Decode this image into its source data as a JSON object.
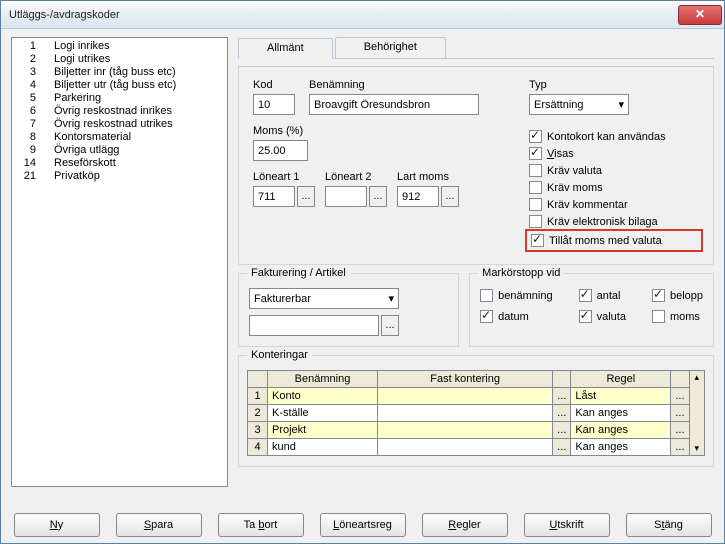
{
  "window": {
    "title": "Utläggs-/avdragskoder"
  },
  "list": [
    {
      "id": "1",
      "label": "Logi inrikes"
    },
    {
      "id": "2",
      "label": "Logi utrikes"
    },
    {
      "id": "3",
      "label": "Biljetter inr (tåg buss etc)"
    },
    {
      "id": "4",
      "label": "Biljetter utr (tåg buss etc)"
    },
    {
      "id": "5",
      "label": "Parkering"
    },
    {
      "id": "6",
      "label": "Övrig reskostnad inrikes"
    },
    {
      "id": "7",
      "label": "Övrig reskostnad utrikes"
    },
    {
      "id": "8",
      "label": "Kontorsmaterial"
    },
    {
      "id": "9",
      "label": "Övriga utlägg"
    },
    {
      "id": "14",
      "label": "Reseförskott"
    },
    {
      "id": "21",
      "label": "Privatköp"
    }
  ],
  "tabs": {
    "general": "Allmänt",
    "permissions": "Behörighet"
  },
  "general": {
    "kod_label": "Kod",
    "kod": "10",
    "ben_label": "Benämning",
    "ben": "Broavgift Öresundsbron",
    "typ_label": "Typ",
    "typ": "Ersättning",
    "moms_label": "Moms (%)",
    "moms": "25.00",
    "loneart1_label": "Löneart 1",
    "loneart1": "711",
    "loneart2_label": "Löneart 2",
    "loneart2": "",
    "lartmoms_label": "Lart moms",
    "lartmoms": "912",
    "checks": {
      "kontokort": {
        "label": "Kontokort kan användas",
        "checked": true
      },
      "visas": {
        "label": "Visas",
        "checked": true,
        "u": "V"
      },
      "krav_valuta": {
        "label": "Kräv valuta",
        "checked": false
      },
      "krav_moms": {
        "label": "Kräv moms",
        "checked": false
      },
      "krav_komm": {
        "label": "Kräv kommentar",
        "checked": false
      },
      "krav_ebil": {
        "label": "Kräv elektronisk bilaga",
        "checked": false
      },
      "tillat": {
        "label": "Tillåt moms med valuta",
        "checked": true
      }
    }
  },
  "fakturering": {
    "legend": "Fakturering / Artikel",
    "combo": "Fakturerbar",
    "text": ""
  },
  "marker": {
    "legend": "Markörstopp vid",
    "benamning": {
      "label": "benämning",
      "checked": false
    },
    "antal": {
      "label": "antal",
      "checked": true
    },
    "belopp": {
      "label": "belopp",
      "checked": true
    },
    "datum": {
      "label": "datum",
      "checked": true
    },
    "valuta": {
      "label": "valuta",
      "checked": true
    },
    "moms": {
      "label": "moms",
      "checked": false
    }
  },
  "kont": {
    "legend": "Konteringar",
    "headers": {
      "ben": "Benämning",
      "fast": "Fast kontering",
      "regel": "Regel"
    },
    "rows": [
      {
        "n": "1",
        "ben": "Konto",
        "fast": "",
        "regel": "Låst",
        "yellow": true
      },
      {
        "n": "2",
        "ben": "K-ställe",
        "fast": "",
        "regel": "Kan anges",
        "yellow": false
      },
      {
        "n": "3",
        "ben": "Projekt",
        "fast": "",
        "regel": "Kan anges",
        "yellow": true
      },
      {
        "n": "4",
        "ben": "kund",
        "fast": "",
        "regel": "Kan anges",
        "yellow": false
      }
    ]
  },
  "buttons": {
    "ny": "Ny",
    "spara": "Spara",
    "tabort": "Ta bort",
    "loneart": "Löneartsreg",
    "regler": "Regler",
    "utskrift": "Utskrift",
    "stang": "Stäng"
  }
}
